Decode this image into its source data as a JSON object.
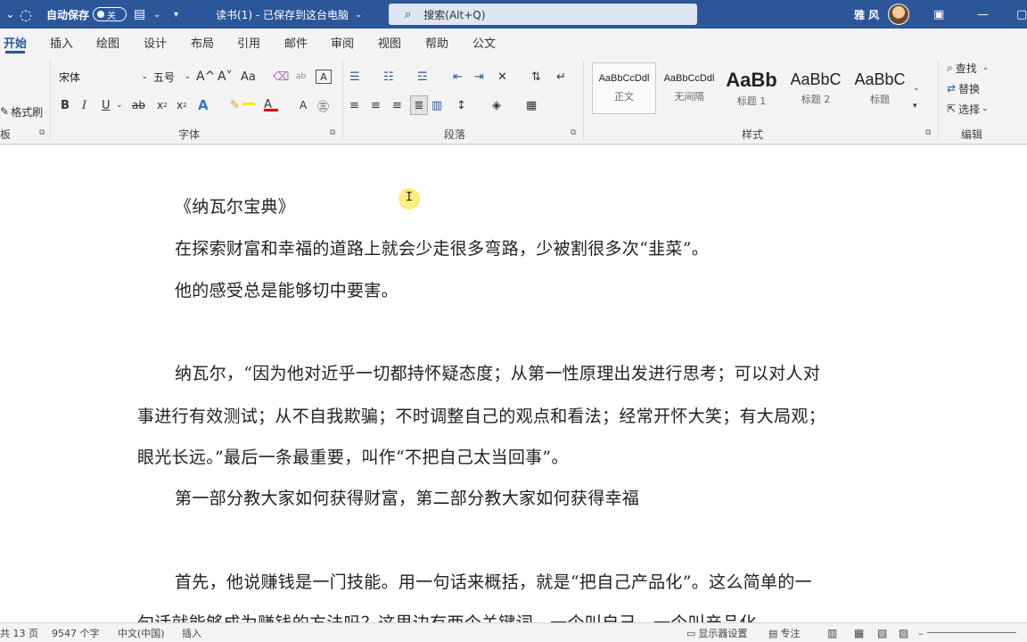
{
  "titlebar": {
    "autosave_label": "自动保存",
    "autosave_state": "关",
    "doc_title": "读书(1) - 已保存到这台电脑",
    "search_placeholder": "搜索(Alt+Q)",
    "user_name": "雅 风",
    "bg_color": "#2b579a"
  },
  "tabs": [
    "开始",
    "插入",
    "绘图",
    "设计",
    "布局",
    "引用",
    "邮件",
    "审阅",
    "视图",
    "帮助",
    "公文"
  ],
  "ribbon": {
    "clipboard": {
      "format_painter": "格式刷",
      "group_label": "板"
    },
    "font": {
      "font_name": "宋体",
      "font_size": "五号",
      "grow": "A^",
      "shrink": "A˅",
      "change_case": "Aa",
      "bold": "B",
      "italic": "I",
      "underline": "U",
      "strike": "ab",
      "subscript": "x",
      "superscript": "x",
      "font_color": "A",
      "char_shading": "A",
      "group_label": "字体"
    },
    "paragraph": {
      "group_label": "段落"
    },
    "styles": {
      "items": [
        {
          "sample": "AaBbCcDdl",
          "name": "正文"
        },
        {
          "sample": "AaBbCcDdl",
          "name": "无间隔"
        },
        {
          "sample": "AaBb",
          "name": "标题 1"
        },
        {
          "sample": "AaBbC",
          "name": "标题 2"
        },
        {
          "sample": "AaBbC",
          "name": "标题"
        }
      ],
      "group_label": "样式"
    },
    "editing": {
      "find": "查找",
      "replace": "替换",
      "select": "选择",
      "group_label": "编辑"
    }
  },
  "document": {
    "lines": [
      "《纳瓦尔宝典》",
      "在探索财富和幸福的道路上就会少走很多弯路，少被割很多次“韭菜”。",
      "他的感受总是能够切中要害。",
      "纳瓦尔，“因为他对近乎一切都持怀疑态度；从第一性原理出发进行思考；可以对人对",
      "事进行有效测试；从不自我欺骗；不时调整自己的观点和看法；经常开怀大笑；有大局观；",
      "眼光长远。”最后一条最重要，叫作“不把自己太当回事”。",
      "第一部分教大家如何获得财富，第二部分教大家如何获得幸福",
      "首先，他说赚钱是一门技能。用一句话来概括，就是“把自己产品化”。这么简单的一",
      "句话就能够成为赚钱的方法吗？这里边有两个关键词，一个叫自己，一个叫产品化"
    ]
  },
  "statusbar": {
    "page_info": "共 13 页",
    "word_count": "9547 个字",
    "language": "中文(中国)",
    "insert_mode": "插入",
    "display_settings": "显示器设置",
    "focus": "专注"
  }
}
